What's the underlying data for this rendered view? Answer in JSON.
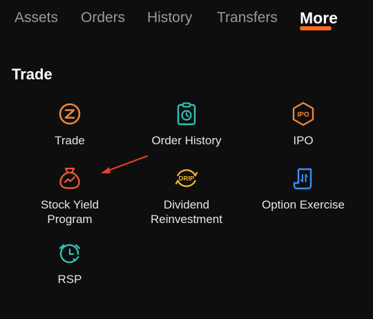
{
  "tabs": [
    {
      "label": "Assets"
    },
    {
      "label": "Orders"
    },
    {
      "label": "History"
    },
    {
      "label": "Transfers"
    },
    {
      "label": "More",
      "active": true
    }
  ],
  "section": {
    "title": "Trade"
  },
  "tiles": [
    {
      "label": "Trade",
      "icon": "trade-z-circle-icon"
    },
    {
      "label": "Order History",
      "icon": "clipboard-clock-icon"
    },
    {
      "label": "IPO",
      "icon": "ipo-hexagon-icon"
    },
    {
      "label": "Stock Yield\nProgram",
      "icon": "money-bag-chart-icon"
    },
    {
      "label": "Dividend\nReinvestment",
      "icon": "drip-badge-icon",
      "badge": "DRIP"
    },
    {
      "label": "Option Exercise",
      "icon": "option-exercise-document-icon"
    },
    {
      "label": "RSP",
      "icon": "alarm-clock-icon"
    }
  ],
  "colors": {
    "accent": "#ff6a1f",
    "orange": "#f0873a",
    "teal": "#33c1b5",
    "red_orange": "#ee5a36",
    "yellow": "#f2b233",
    "blue": "#3c8ef2",
    "annotation_arrow": "#e8402a"
  }
}
